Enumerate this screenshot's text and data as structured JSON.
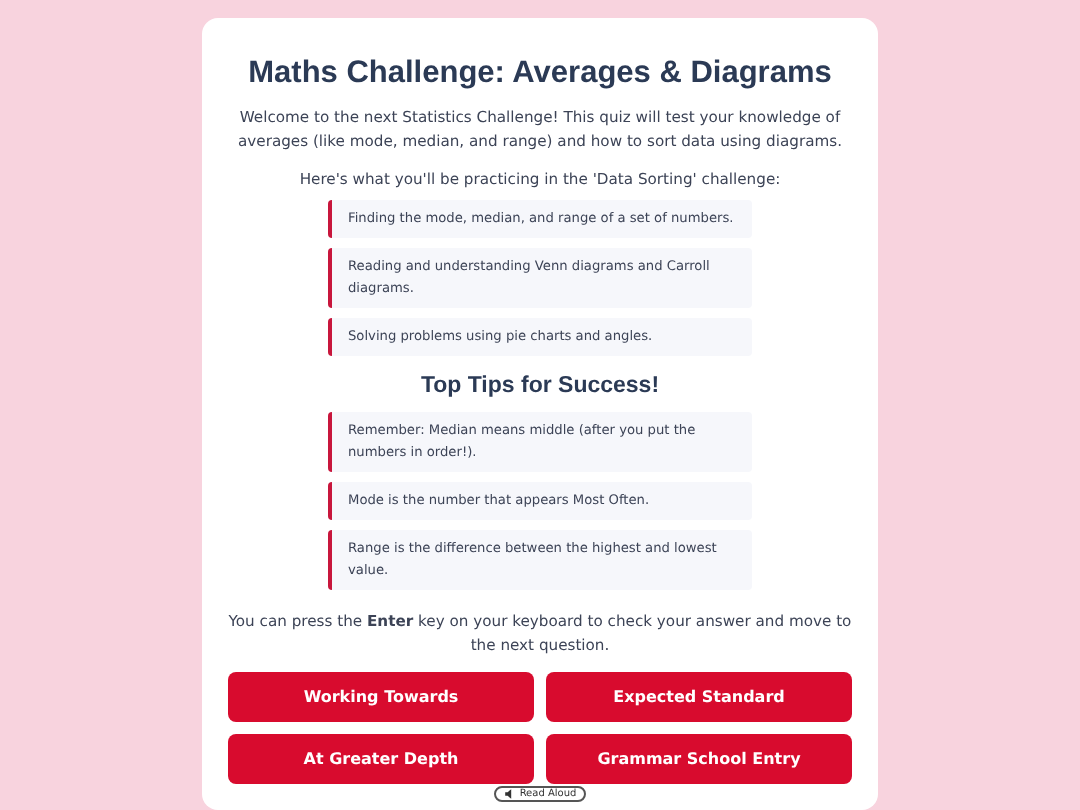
{
  "title": "Maths Challenge: Averages & Diagrams",
  "intro": "Welcome to the next Statistics Challenge! This quiz will test your knowledge of averages (like mode, median, and range) and how to sort data using diagrams.",
  "practice_heading": "Here's what you'll be practicing in the 'Data Sorting' challenge:",
  "practice_items": [
    "Finding the mode, median, and range of a set of numbers.",
    "Reading and understanding Venn diagrams and Carroll diagrams.",
    "Solving problems using pie charts and angles."
  ],
  "tips_heading": "Top Tips for Success!",
  "tips": [
    "Remember: Median means middle (after you put the numbers in order!).",
    "Mode is the number that appears Most Often.",
    "Range is the difference between the highest and lowest value."
  ],
  "keyboard_hint": "You can press the **Enter** key on your keyboard to check your answer and move to the next question.",
  "level_buttons": [
    "Working Towards",
    "Expected Standard",
    "At Greater Depth",
    "Grammar School Entry"
  ],
  "read_aloud": "Read Aloud"
}
